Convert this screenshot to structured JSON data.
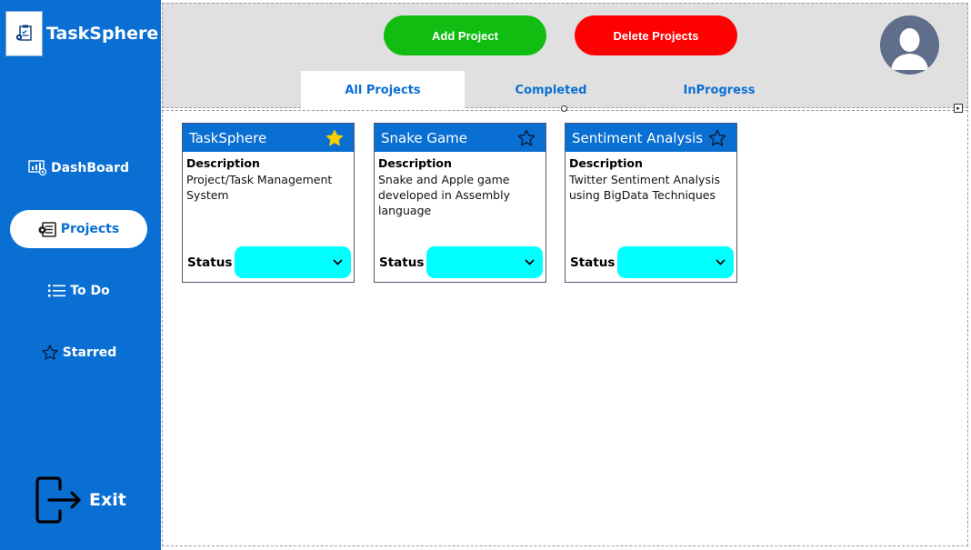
{
  "app": {
    "name": "TaskSphere"
  },
  "sidebar": {
    "items": [
      {
        "label": "DashBoard",
        "icon": "dashboard-icon"
      },
      {
        "label": "Projects",
        "icon": "projects-icon",
        "active": true
      },
      {
        "label": "To Do",
        "icon": "list-icon"
      },
      {
        "label": "Starred",
        "icon": "star-outline-icon"
      }
    ],
    "exit_label": "Exit"
  },
  "header": {
    "add_label": "Add Project",
    "delete_label": "Delete Projects",
    "tabs": [
      {
        "label": "All Projects",
        "active": true
      },
      {
        "label": "Completed"
      },
      {
        "label": "InProgress"
      }
    ]
  },
  "projects": [
    {
      "title": "TaskSphere",
      "starred": true,
      "description_label": "Description",
      "description": "Project/Task Management System",
      "status_label": "Status",
      "status_value": ""
    },
    {
      "title": "Snake Game",
      "starred": false,
      "description_label": "Description",
      "description": "Snake and Apple game developed in Assembly language",
      "status_label": "Status",
      "status_value": ""
    },
    {
      "title": "Sentiment Analysis",
      "starred": false,
      "description_label": "Description",
      "description": "Twitter Sentiment Analysis using BigData Techniques",
      "status_label": "Status",
      "status_value": ""
    }
  ],
  "colors": {
    "primary": "#0a6fd3",
    "add": "#10bd10",
    "delete": "#fd0000",
    "status_bg": "#00ffff",
    "star_filled": "#f5d000"
  }
}
